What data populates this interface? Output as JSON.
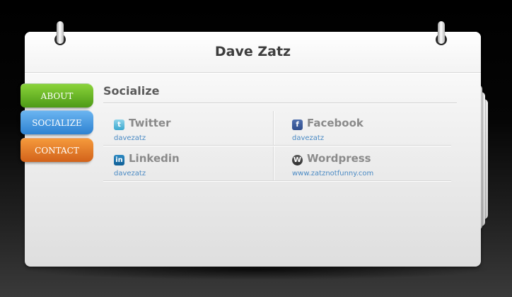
{
  "header": {
    "site_name": "Dave Zatz"
  },
  "tabs": [
    {
      "label": "ABOUT",
      "color": "#5aa820"
    },
    {
      "label": "SOCIALIZE",
      "color": "#3a8fdc"
    },
    {
      "label": "CONTACT",
      "color": "#e2742a"
    }
  ],
  "section": {
    "title": "Socialize"
  },
  "social": [
    {
      "name": "Twitter",
      "handle": "davezatz",
      "icon": "twitter-icon",
      "glyph": "t"
    },
    {
      "name": "Facebook",
      "handle": "davezatz",
      "icon": "facebook-icon",
      "glyph": "f"
    },
    {
      "name": "Linkedin",
      "handle": "davezatz",
      "icon": "linkedin-icon",
      "glyph": "in"
    },
    {
      "name": "Wordpress",
      "handle": "www.zatznotfunny.com",
      "icon": "wordpress-icon",
      "glyph": "W"
    }
  ],
  "colors": {
    "link": "#4a8ac4",
    "title_text": "#3d3d3d"
  }
}
